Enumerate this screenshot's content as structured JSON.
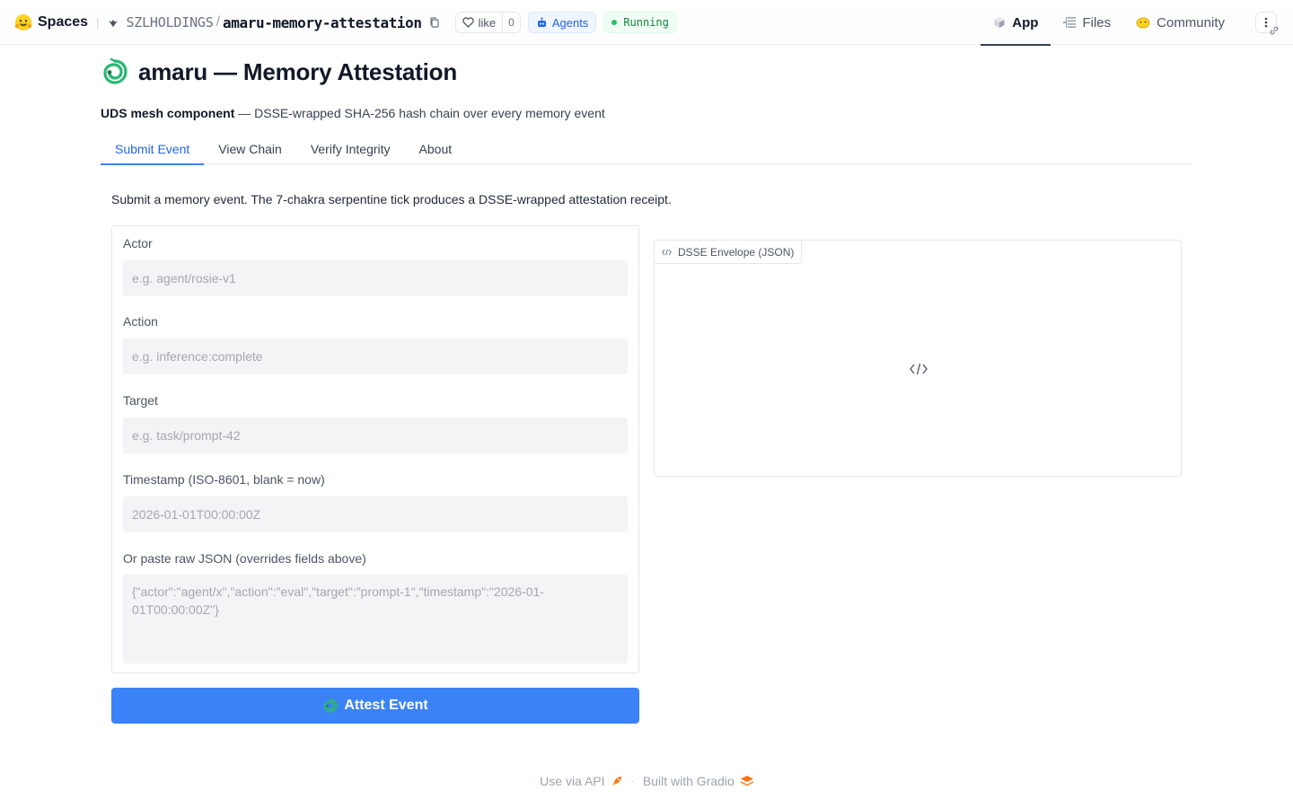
{
  "topbar": {
    "spaces_label": "Spaces",
    "owner": "SZLHOLDINGS",
    "repo": "amaru-memory-attestation",
    "like_label": "like",
    "like_count": "0",
    "agents_label": "Agents",
    "status_label": "Running",
    "nav": [
      {
        "label": "App",
        "icon": "app-cube-icon",
        "active": true
      },
      {
        "label": "Files",
        "icon": "files-icon",
        "active": false
      },
      {
        "label": "Community",
        "icon": "community-icon",
        "active": false
      }
    ]
  },
  "header": {
    "title": "amaru — Memory Attestation",
    "subtitle_bold": "UDS mesh component",
    "subtitle_rest": " — DSSE-wrapped SHA-256 hash chain over every memory event"
  },
  "tabs": [
    {
      "label": "Submit Event",
      "active": true
    },
    {
      "label": "View Chain",
      "active": false
    },
    {
      "label": "Verify Integrity",
      "active": false
    },
    {
      "label": "About",
      "active": false
    }
  ],
  "submit": {
    "description": "Submit a memory event. The 7-chakra serpentine tick produces a DSSE-wrapped attestation receipt.",
    "fields": {
      "actor": {
        "label": "Actor",
        "placeholder": "e.g. agent/rosie-v1",
        "value": ""
      },
      "action": {
        "label": "Action",
        "placeholder": "e.g. inference:complete",
        "value": ""
      },
      "target": {
        "label": "Target",
        "placeholder": "e.g. task/prompt-42",
        "value": ""
      },
      "timestamp": {
        "label": "Timestamp (ISO-8601, blank = now)",
        "placeholder": "2026-01-01T00:00:00Z",
        "value": ""
      },
      "raw_json": {
        "label": "Or paste raw JSON (overrides fields above)",
        "placeholder": "{\"actor\":\"agent/x\",\"action\":\"eval\",\"target\":\"prompt-1\",\"timestamp\":\"2026-01-01T00:00:00Z\"}",
        "value": ""
      }
    },
    "button_label": "Attest Event"
  },
  "output": {
    "label": "DSSE Envelope (JSON)"
  },
  "footer": {
    "api_label": "Use via API",
    "separator": "·",
    "built_label": "Built with Gradio"
  },
  "colors": {
    "accent": "#3b82f6",
    "running": "#22c55e",
    "agents": "#2563eb",
    "serpent": "#2bb673"
  }
}
